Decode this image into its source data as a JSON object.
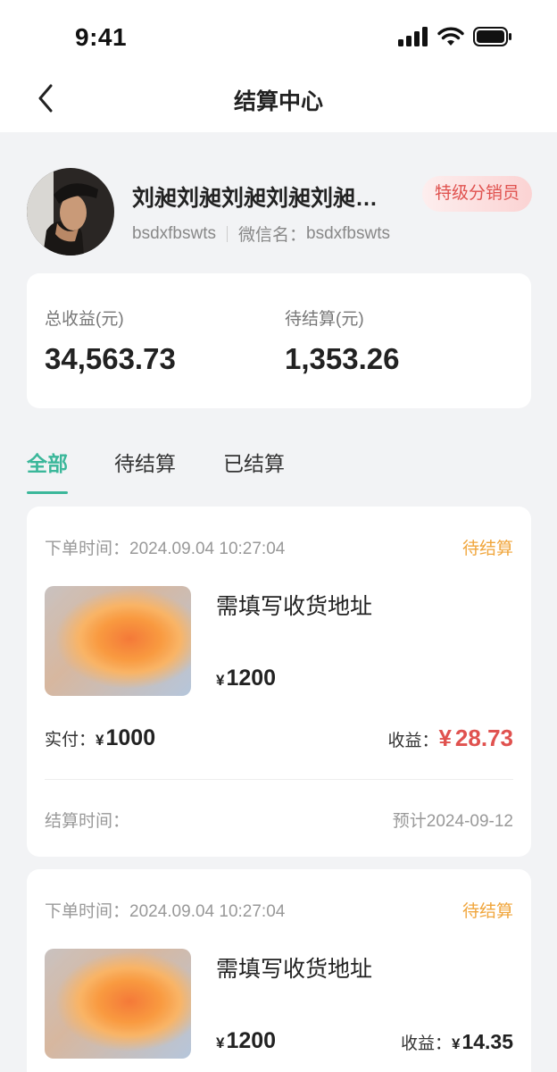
{
  "status_bar": {
    "time": "9:41"
  },
  "nav": {
    "title": "结算中心"
  },
  "profile": {
    "name": "刘昶刘昶刘昶刘昶刘昶刘昶刘昶",
    "badge": "特级分销员",
    "account": "bsdxfbswts",
    "wechat_label": "微信名：",
    "wechat_name": "bsdxfbswts"
  },
  "summary": {
    "total_label": "总收益(元)",
    "total_value": "34,563.73",
    "pending_label": "待结算(元)",
    "pending_value": "1,353.26"
  },
  "tabs": [
    {
      "label": "全部",
      "active": true
    },
    {
      "label": "待结算",
      "active": false
    },
    {
      "label": "已结算",
      "active": false
    }
  ],
  "orders": [
    {
      "order_time_label": "下单时间：",
      "order_time": "2024.09.04 10:27:04",
      "status": "待结算",
      "product_name": "需填写收货地址",
      "currency": "¥",
      "price": "1200",
      "paid_label": "实付：",
      "paid": "1000",
      "income_label": "收益：",
      "income": "28.73",
      "settle_label": "结算时间：",
      "settle_time": "预计2024-09-12"
    },
    {
      "order_time_label": "下单时间：",
      "order_time": "2024.09.04 10:27:04",
      "status": "待结算",
      "product_name": "需填写收货地址",
      "currency": "¥",
      "price": "1200",
      "income_label": "收益：",
      "income": "14.35"
    }
  ],
  "colors": {
    "accent": "#3bb79a",
    "pending": "#f0a53b",
    "income": "#e0524f",
    "badge_text": "#e0524f"
  },
  "icons": [
    "back-icon",
    "signal-icon",
    "wifi-icon",
    "battery-icon"
  ]
}
